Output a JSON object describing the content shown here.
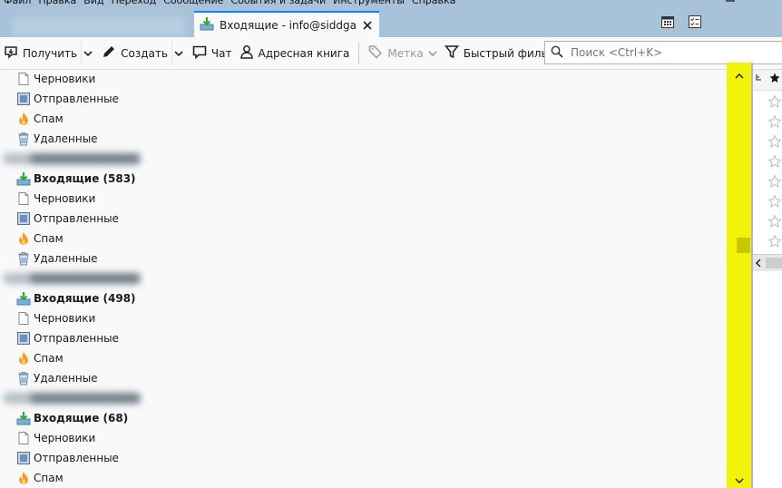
{
  "menu": [
    "Файл",
    "Правка",
    "Вид",
    "Переход",
    "Сообщение",
    "События и задачи",
    "Инструменты",
    "Справка"
  ],
  "tab": {
    "title": "Входящие - info@siddgame"
  },
  "toolbar": {
    "get_messages": "Получить",
    "write": "Создать",
    "chat": "Чат",
    "address_book": "Адресная книга",
    "tag": "Метка",
    "quick_filter": "Быстрый фильтр"
  },
  "search": {
    "placeholder": "Поиск <Ctrl+K>"
  },
  "folders": {
    "g1": {
      "drafts": "Черновики",
      "sent": "Отправленные",
      "spam": "Спам",
      "trash": "Удаленные"
    },
    "g2": {
      "inbox": "Входящие (583)",
      "drafts": "Черновики",
      "sent": "Отправленные",
      "spam": "Спам",
      "trash": "Удаленные"
    },
    "g3": {
      "inbox": "Входящие (498)",
      "drafts": "Черновики",
      "sent": "Отправленные",
      "spam": "Спам",
      "trash": "Удаленные"
    },
    "g4": {
      "inbox": "Входящие (68)",
      "drafts": "Черновики",
      "sent": "Отправленные",
      "spam": "Спам"
    }
  },
  "colors": {
    "accent": "#0a84ff",
    "scrollbar": "#f2f20a",
    "tabstrip": "#a8c3d9"
  },
  "icons": [
    "inbox-icon",
    "drafts-icon",
    "sent-icon",
    "spam-icon",
    "trash-icon",
    "calendar-icon",
    "tasks-icon",
    "close-icon",
    "star-icon",
    "search-icon",
    "tag-icon",
    "filter-icon",
    "chat-icon",
    "address-book-icon",
    "pencil-icon",
    "get-messages-icon"
  ]
}
